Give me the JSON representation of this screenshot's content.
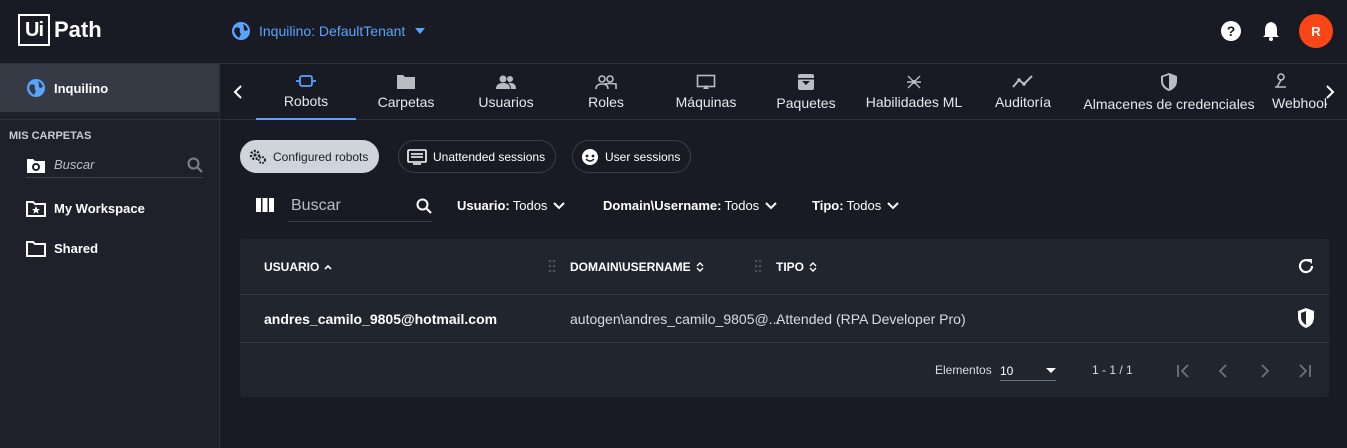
{
  "header": {
    "logo_box": "Ui",
    "logo_text": "Path",
    "tenant_label": "Inquilino: DefaultTenant",
    "avatar_initial": "R",
    "accent_color": "#5aa3ff",
    "avatar_color": "#fa4616"
  },
  "sidebar": {
    "tenant_item": "Inquilino",
    "section_heading": "MIS CARPETAS",
    "search_placeholder": "Buscar",
    "items": [
      {
        "label": "My Workspace",
        "icon": "folder-star-icon"
      },
      {
        "label": "Shared",
        "icon": "folder-icon"
      }
    ]
  },
  "tabs": [
    {
      "label": "Robots",
      "icon": "robot-icon",
      "active": true
    },
    {
      "label": "Carpetas",
      "icon": "folder-icon"
    },
    {
      "label": "Usuarios",
      "icon": "users-icon"
    },
    {
      "label": "Roles",
      "icon": "roles-icon"
    },
    {
      "label": "Máquinas",
      "icon": "monitor-icon"
    },
    {
      "label": "Paquetes",
      "icon": "package-icon"
    },
    {
      "label": "Habilidades ML",
      "icon": "ml-icon"
    },
    {
      "label": "Auditoría",
      "icon": "chart-line-icon"
    },
    {
      "label": "Almacenes de credenciales",
      "icon": "shield-icon"
    },
    {
      "label": "Webhooks",
      "icon": "webhook-icon"
    }
  ],
  "chips": [
    {
      "label": "Configured robots",
      "active": true
    },
    {
      "label": "Unattended sessions"
    },
    {
      "label": "User sessions"
    }
  ],
  "filters": {
    "search_placeholder": "Buscar",
    "usuario_label": "Usuario:",
    "usuario_value": "Todos",
    "domain_label": "Domain\\Username:",
    "domain_value": "Todos",
    "tipo_label": "Tipo:",
    "tipo_value": "Todos"
  },
  "table": {
    "columns": [
      "USUARIO",
      "DOMAIN\\USERNAME",
      "TIPO"
    ],
    "rows": [
      {
        "usuario": "andres_camilo_9805@hotmail.com",
        "domain": "autogen\\andres_camilo_9805@...",
        "tipo": "Attended (RPA Developer Pro)"
      }
    ]
  },
  "pager": {
    "items_label": "Elementos",
    "page_size": "10",
    "range": "1 - 1 / 1"
  }
}
